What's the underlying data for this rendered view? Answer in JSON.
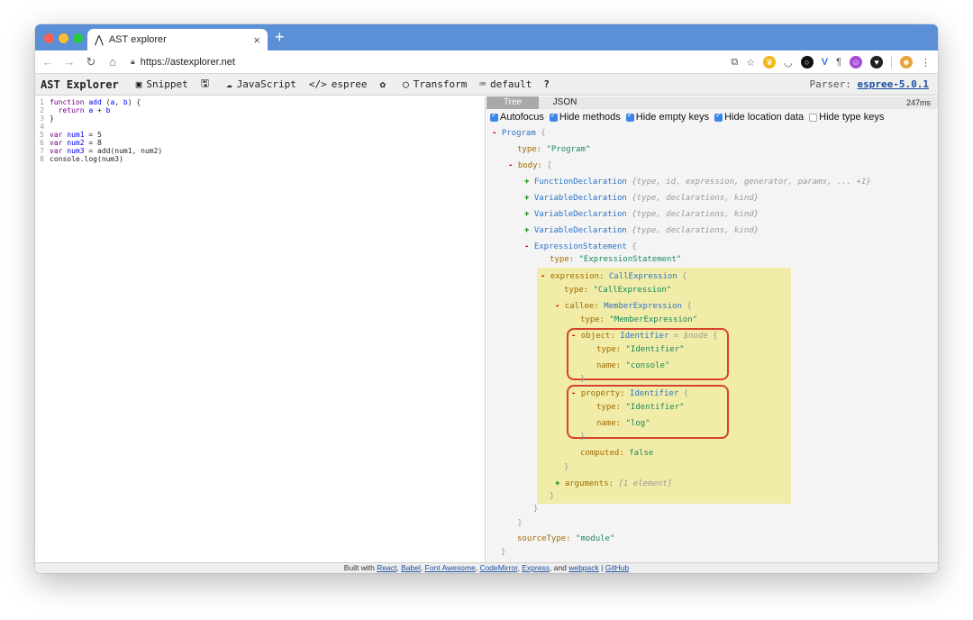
{
  "browser": {
    "tab_title": "AST explorer",
    "tab_close": "×",
    "new_tab": "+",
    "url": "https://astexplorer.net"
  },
  "app": {
    "brand": "AST Explorer",
    "snippet": "Snippet",
    "language": "JavaScript",
    "parser_btn": "espree",
    "transform": "Transform",
    "keymap": "default",
    "help": "?",
    "parser_label": "Parser:",
    "parser_version": "espree-5.0.1"
  },
  "editor": {
    "lines": [
      "function add (a, b) {",
      "  return a + b",
      "}",
      "",
      "var num1 = 5",
      "var num2 = 8",
      "var num3 = add(num1, num2)",
      "console.log(num3)"
    ]
  },
  "right": {
    "tab_tree": "Tree",
    "tab_json": "JSON",
    "timing": "247ms",
    "options": [
      {
        "label": "Autofocus",
        "checked": true
      },
      {
        "label": "Hide methods",
        "checked": true
      },
      {
        "label": "Hide empty keys",
        "checked": true
      },
      {
        "label": "Hide location data",
        "checked": true
      },
      {
        "label": "Hide type keys",
        "checked": false
      }
    ]
  },
  "tree": {
    "program": "Program",
    "program_type": "\"Program\"",
    "body_key": "body:",
    "func_decl": "FunctionDeclaration",
    "func_meta": "{type, id, expression, generator, params, ... +1}",
    "var_decl": "VariableDeclaration",
    "var_meta": "{type, declarations, kind}",
    "expr_stmt": "ExpressionStatement",
    "expr_stmt_type": "\"ExpressionStatement\"",
    "expression_key": "expression:",
    "call_expr": "CallExpression",
    "call_expr_type": "\"CallExpression\"",
    "callee_key": "callee:",
    "member_expr": "MemberExpression",
    "member_expr_type": "\"MemberExpression\"",
    "object_key": "object:",
    "identifier": "Identifier",
    "node_var": "= $node",
    "identifier_type": "\"Identifier\"",
    "name_console": "\"console\"",
    "property_key": "property:",
    "name_log": "\"log\"",
    "computed_key": "computed:",
    "computed_val": "false",
    "arguments_key": "arguments:",
    "arguments_meta": "[1 element]",
    "source_type_key": "sourceType:",
    "source_type_val": "\"module\"",
    "type_key": "type:",
    "name_key": "name:"
  },
  "footer": {
    "prefix": "Built with",
    "links": [
      "React",
      "Babel",
      "Font Awesome",
      "CodeMirror",
      "Express",
      "webpack",
      "GitHub"
    ]
  }
}
